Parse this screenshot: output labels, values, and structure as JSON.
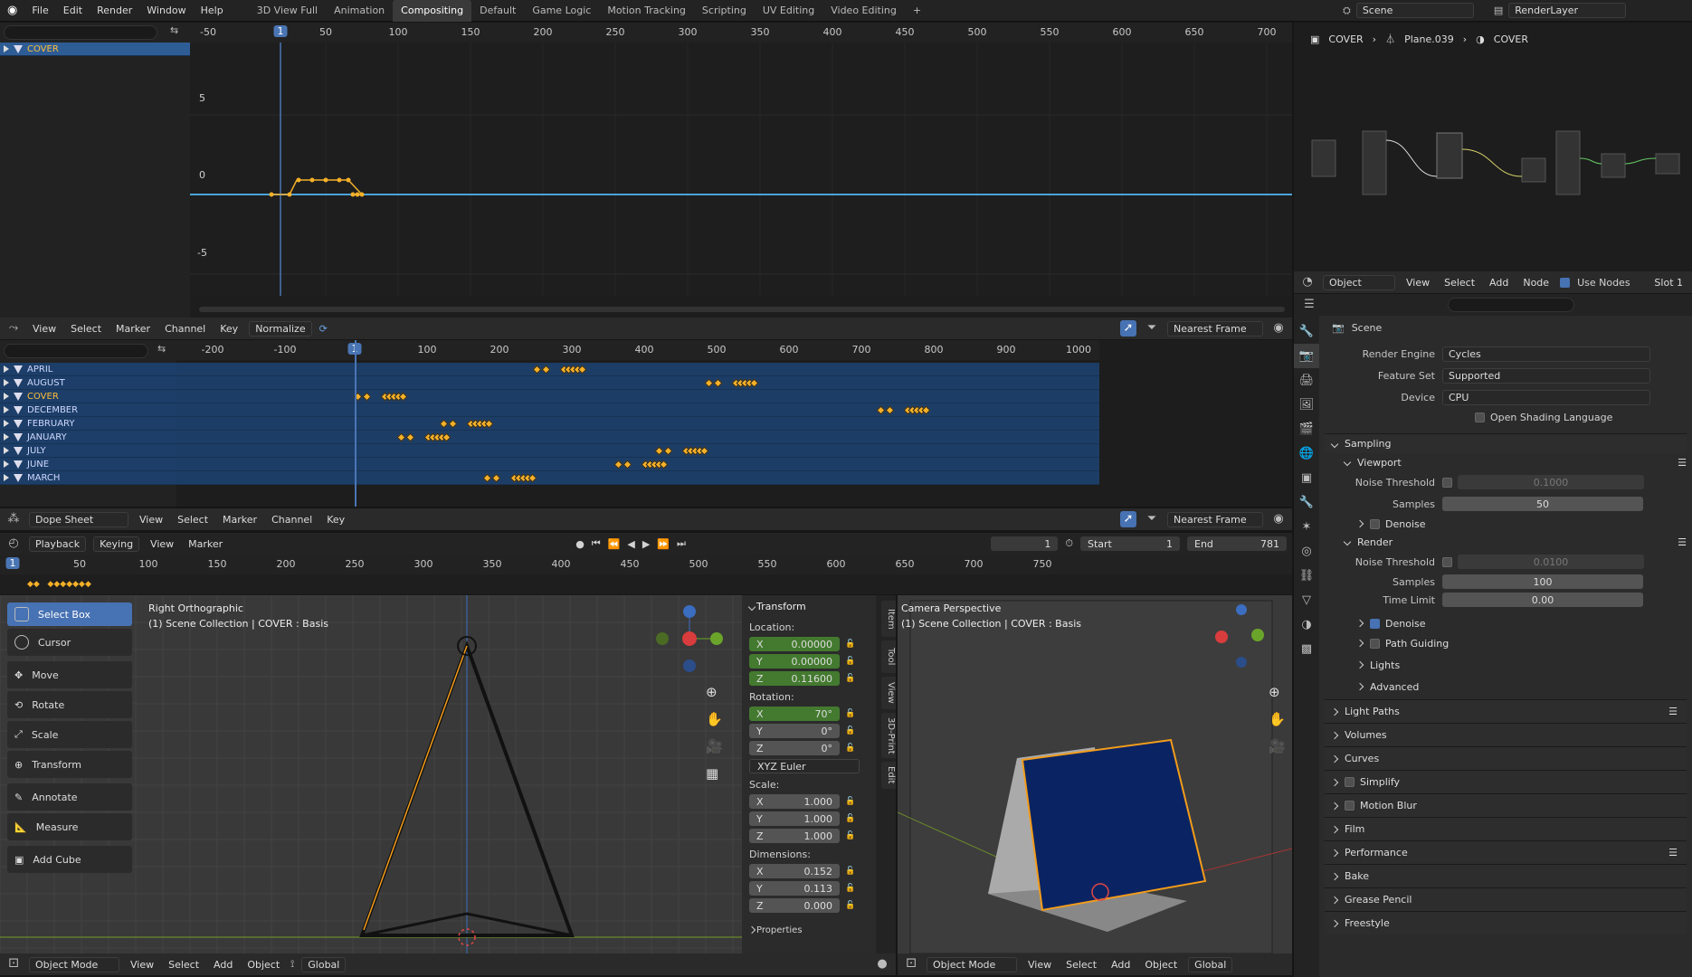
{
  "topbar": {
    "menus": [
      "File",
      "Edit",
      "Render",
      "Window",
      "Help"
    ],
    "workspaces": [
      "3D View Full",
      "Animation",
      "Compositing",
      "Default",
      "Game Logic",
      "Motion Tracking",
      "Scripting",
      "UV Editing",
      "Video Editing"
    ],
    "active_workspace": "Compositing",
    "add": "+",
    "scene": "Scene",
    "render_layer": "RenderLayer"
  },
  "graph": {
    "outliner_item": "COVER",
    "ticks": [
      "-50",
      "1",
      "50",
      "100",
      "150",
      "200",
      "250",
      "300",
      "350",
      "400",
      "450",
      "500",
      "550",
      "600",
      "650",
      "700"
    ],
    "yticks": [
      "5",
      "0",
      "-5"
    ],
    "header": {
      "menus": [
        "View",
        "Select",
        "Marker",
        "Channel",
        "Key"
      ],
      "normalize": "Normalize",
      "snap": "Nearest Frame"
    }
  },
  "node": {
    "breadcrumb": [
      "COVER",
      "Plane.039",
      "COVER"
    ],
    "header": {
      "mode": "Object",
      "menus": [
        "View",
        "Select",
        "Add",
        "Node"
      ],
      "use_nodes": "Use Nodes",
      "slot": "Slot 1"
    }
  },
  "dopesheet": {
    "ticks": [
      "-200",
      "-100",
      "1",
      "100",
      "200",
      "300",
      "400",
      "500",
      "600",
      "700",
      "800",
      "900",
      "1000"
    ],
    "channels": [
      "APRIL",
      "AUGUST",
      "COVER",
      "DECEMBER",
      "FEBRUARY",
      "JANUARY",
      "JULY",
      "JUNE",
      "MARCH"
    ],
    "header": {
      "mode": "Dope Sheet",
      "menus": [
        "View",
        "Select",
        "Marker",
        "Channel",
        "Key"
      ],
      "snap": "Nearest Frame"
    }
  },
  "timeline": {
    "menus": [
      "Playback",
      "Keying",
      "View",
      "Marker"
    ],
    "current": "1",
    "start_label": "Start",
    "start": "1",
    "end_label": "End",
    "end": "781",
    "ticks": [
      "1",
      "50",
      "100",
      "150",
      "200",
      "250",
      "300",
      "350",
      "400",
      "450",
      "500",
      "550",
      "600",
      "650",
      "700",
      "750"
    ]
  },
  "left3d": {
    "view": "Right Orthographic",
    "collection": "(1) Scene Collection | COVER : Basis",
    "tools": [
      "Select Box",
      "Cursor",
      "Move",
      "Rotate",
      "Scale",
      "Transform",
      "Annotate",
      "Measure",
      "Add Cube"
    ],
    "header": {
      "mode": "Object Mode",
      "menus": [
        "View",
        "Select",
        "Add",
        "Object"
      ],
      "orient": "Global"
    }
  },
  "transform": {
    "title": "Transform",
    "location_label": "Location:",
    "location": [
      {
        "a": "X",
        "v": "0.00000"
      },
      {
        "a": "Y",
        "v": "0.00000"
      },
      {
        "a": "Z",
        "v": "0.11600"
      }
    ],
    "rotation_label": "Rotation:",
    "rotation": [
      {
        "a": "X",
        "v": "70°"
      },
      {
        "a": "Y",
        "v": "0°"
      },
      {
        "a": "Z",
        "v": "0°"
      }
    ],
    "euler": "XYZ Euler",
    "scale_label": "Scale:",
    "scale": [
      {
        "a": "X",
        "v": "1.000"
      },
      {
        "a": "Y",
        "v": "1.000"
      },
      {
        "a": "Z",
        "v": "1.000"
      }
    ],
    "dims_label": "Dimensions:",
    "dims": [
      {
        "a": "X",
        "v": "0.152"
      },
      {
        "a": "Y",
        "v": "0.113"
      },
      {
        "a": "Z",
        "v": "0.000"
      }
    ],
    "more": "Properties",
    "tabs": [
      "Item",
      "Tool",
      "View",
      "3D-Print",
      "Edit"
    ]
  },
  "right3d": {
    "view": "Camera Perspective",
    "collection": "(1) Scene Collection | COVER : Basis",
    "header": {
      "mode": "Object Mode",
      "menus": [
        "View",
        "Select",
        "Add",
        "Object"
      ],
      "orient": "Global"
    }
  },
  "props": {
    "scene": "Scene",
    "engine_label": "Render Engine",
    "engine": "Cycles",
    "feature_label": "Feature Set",
    "feature": "Supported",
    "device_label": "Device",
    "device": "CPU",
    "osl": "Open Shading Language",
    "sampling": "Sampling",
    "viewport": "Viewport",
    "noise_label": "Noise Threshold",
    "vp_noise": "0.1000",
    "samples_label": "Samples",
    "vp_samples": "50",
    "denoise": "Denoise",
    "render": "Render",
    "r_noise": "0.0100",
    "r_samples": "100",
    "timelimit_label": "Time Limit",
    "timelimit": "0.00",
    "path_guiding": "Path Guiding",
    "lights": "Lights",
    "advanced": "Advanced",
    "sections": [
      "Light Paths",
      "Volumes",
      "Curves",
      "Simplify",
      "Motion Blur",
      "Film",
      "Performance",
      "Bake",
      "Grease Pencil",
      "Freestyle"
    ]
  },
  "colors": {
    "accent": "#4772b3",
    "key": "#f4b028",
    "channel": "#1c3e68",
    "curve": "#4aa3d9"
  }
}
